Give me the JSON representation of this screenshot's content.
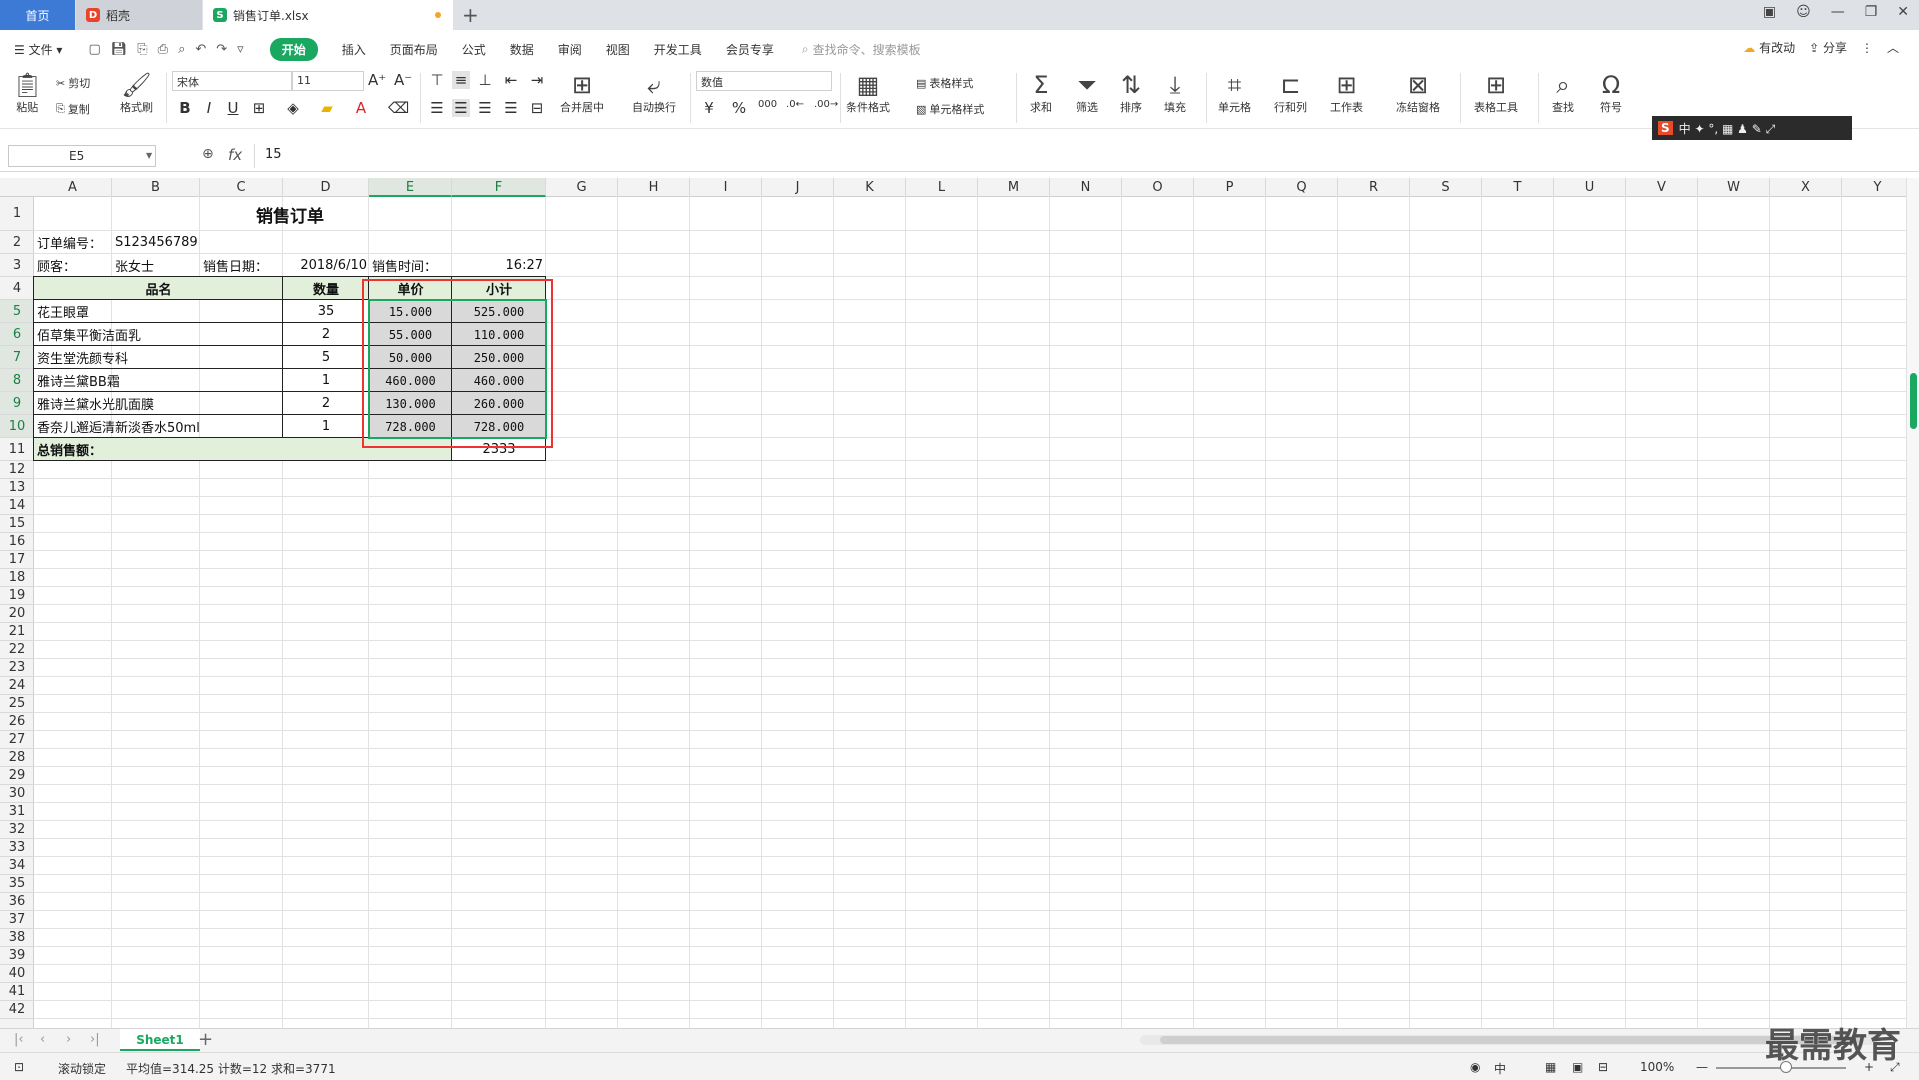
{
  "titlebar": {
    "tabs": [
      {
        "label": "首页"
      },
      {
        "label": "稻壳"
      },
      {
        "label": "销售订单.xlsx"
      }
    ]
  },
  "menu": {
    "file": "文件",
    "items": [
      "开始",
      "插入",
      "页面布局",
      "公式",
      "数据",
      "审阅",
      "视图",
      "开发工具",
      "会员专享"
    ],
    "active": "开始",
    "search_placeholder": "查找命令、搜索模板",
    "right": [
      "有改动",
      "分享"
    ]
  },
  "ribbon": {
    "paste": "粘贴",
    "cut": "剪切",
    "copy": "复制",
    "format_painter": "格式刷",
    "font_name": "宋体",
    "font_size": "11",
    "merge_center": "合并居中",
    "wrap": "自动换行",
    "number_format": "数值",
    "table_style": "表格样式",
    "cond_format": "条件格式",
    "cell_style": "单元格样式",
    "sum": "求和",
    "filter": "筛选",
    "sort": "排序",
    "fill": "填充",
    "cell": "单元格",
    "row_col": "行和列",
    "worksheet": "工作表",
    "freeze": "冻结窗格",
    "table_tools": "表格工具",
    "find": "查找",
    "symbol": "符号"
  },
  "ime": {
    "s": "S",
    "text": "中 ✦ °, ▦ ♟ ✎ ⤢"
  },
  "formulabar": {
    "name_box": "E5",
    "formula": "15"
  },
  "grid": {
    "columns": [
      "A",
      "B",
      "C",
      "D",
      "E",
      "F",
      "G",
      "H",
      "I",
      "J",
      "K",
      "L",
      "M",
      "N",
      "O",
      "P",
      "Q",
      "R",
      "S",
      "T",
      "U",
      "V",
      "W",
      "X",
      "Y"
    ],
    "rows_visible": 42
  },
  "sheet": {
    "title": "销售订单",
    "order_label": "订单编号：",
    "order_no": "S123456789",
    "customer_label": "顾客：",
    "customer": "张女士",
    "date_label": "销售日期：",
    "date": "2018/6/10",
    "time_label": "销售时间：",
    "time": "16:27",
    "headers": {
      "name": "品名",
      "qty": "数量",
      "price": "单价",
      "subtotal": "小计"
    },
    "items": [
      {
        "name": "花王眼罩",
        "qty": "35",
        "price": "15.000",
        "subtotal": "525.000"
      },
      {
        "name": "佰草集平衡洁面乳",
        "qty": "2",
        "price": "55.000",
        "subtotal": "110.000"
      },
      {
        "name": "资生堂洗颜专科",
        "qty": "5",
        "price": "50.000",
        "subtotal": "250.000"
      },
      {
        "name": "雅诗兰黛BB霜",
        "qty": "1",
        "price": "460.000",
        "subtotal": "460.000"
      },
      {
        "name": "雅诗兰黛水光肌面膜",
        "qty": "2",
        "price": "130.000",
        "subtotal": "260.000"
      },
      {
        "name": "香奈儿邂逅清新淡香水50ml",
        "qty": "1",
        "price": "728.000",
        "subtotal": "728.000"
      }
    ],
    "total_label": "总销售额：",
    "total": "2333"
  },
  "sheettabs": {
    "active": "Sheet1"
  },
  "status": {
    "scroll_lock": "滚动锁定",
    "stats": "平均值=314.25  计数=12  求和=3771",
    "zoom": "100%",
    "ime": "中"
  },
  "watermark": "最需教育",
  "colors": {
    "accent": "#1aa861",
    "home_tab": "#3d7ad6",
    "highlight_box": "#ee3333",
    "header_fill": "#e2efda"
  }
}
